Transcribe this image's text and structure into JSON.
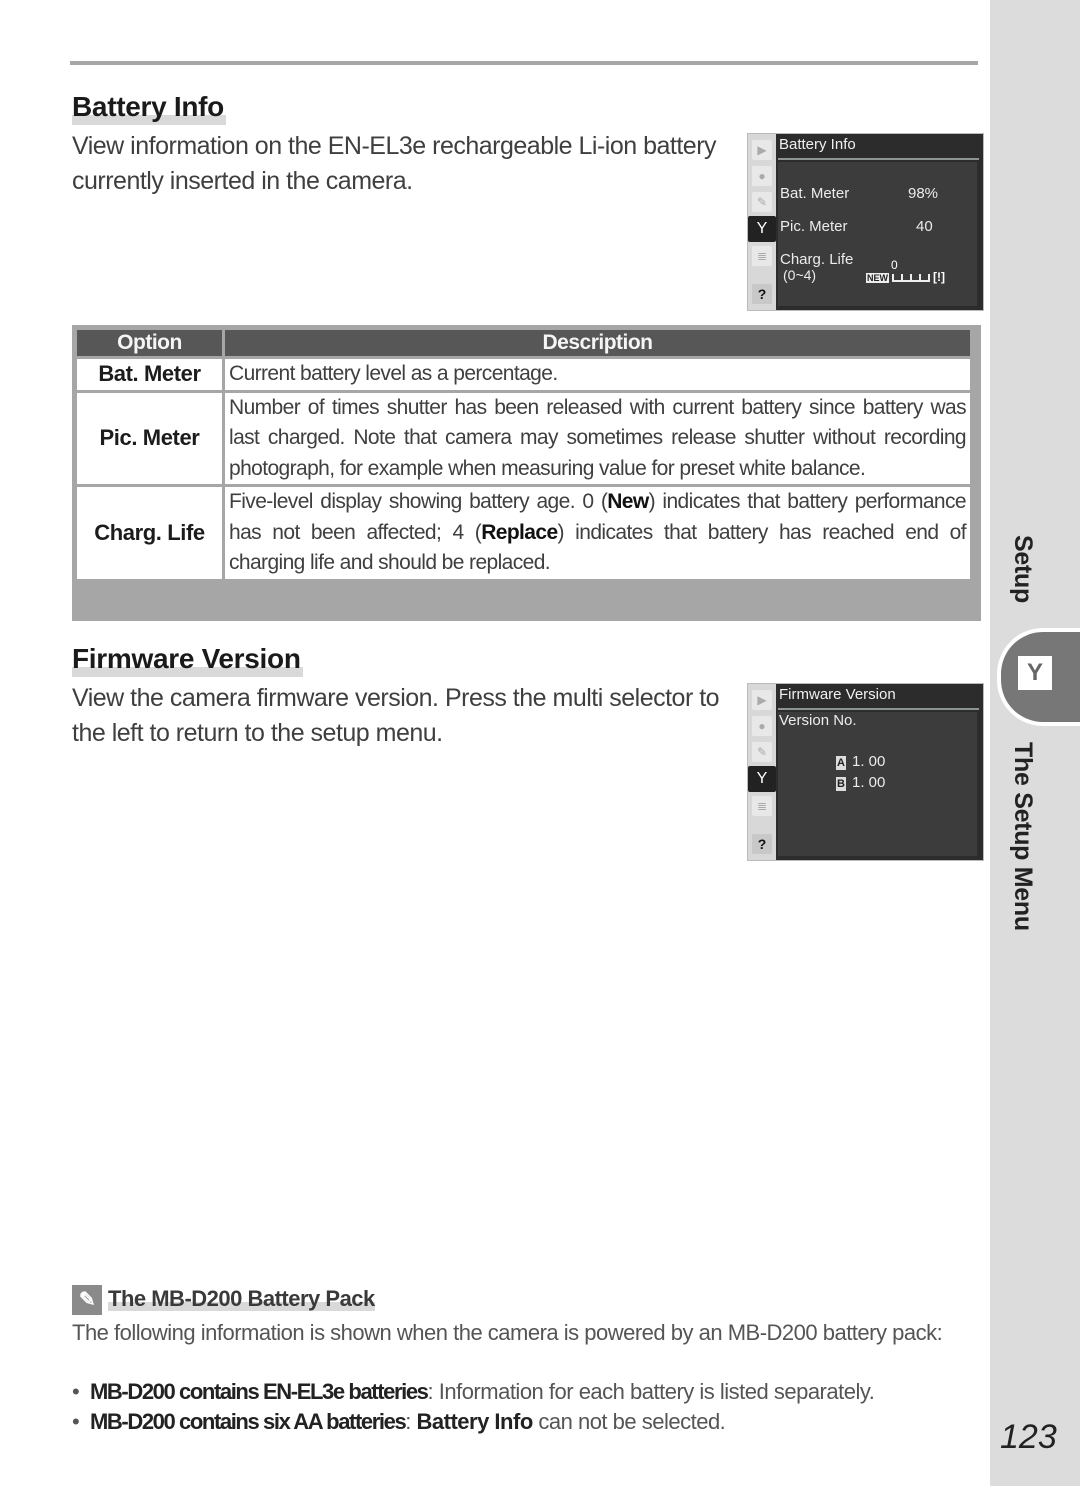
{
  "battery_info": {
    "heading": "Battery Info",
    "intro": "View information on the EN-EL3e rechargeable Li-ion battery currently inserted in the camera.",
    "screen": {
      "title": "Battery Info",
      "sidebar_icons": [
        "playback-icon",
        "shooting-icon",
        "custom-settings-icon",
        "setup-icon",
        "my-menu-icon",
        "help-icon"
      ],
      "help_glyph": "?",
      "rows": [
        {
          "label": "Bat. Meter",
          "value": "98%"
        },
        {
          "label": "Pic. Meter",
          "value": "40"
        },
        {
          "label": "Charg. Life",
          "sublabel": "(0~4)",
          "value": "0"
        }
      ],
      "gauge": {
        "new_label": "NEW",
        "replace_glyph": "!",
        "level": 0,
        "max": 4
      }
    }
  },
  "table": {
    "headers": [
      "Option",
      "Description"
    ],
    "rows": [
      {
        "option": "Bat. Meter",
        "description": "Current battery level as a percentage."
      },
      {
        "option": "Pic. Meter",
        "description": "Number of times shutter has been released with current battery since battery was last charged.  Note that camera may sometimes release shutter without recording photograph, for example when measuring value for preset white balance."
      },
      {
        "option": "Charg. Life",
        "description_parts": [
          "Five-level display showing battery age.  0 (",
          "New",
          ") indicates that battery performance has not been affected; 4 (",
          "Replace",
          ") indicates that battery has reached end of charging life and should be replaced."
        ]
      }
    ]
  },
  "firmware": {
    "heading": "Firmware Version",
    "intro": "View the camera firmware version.  Press the multi selector to the left to return to the setup menu.",
    "screen": {
      "title": "Firmware Version",
      "label": "Version No.",
      "versions": [
        {
          "tag": "A",
          "value": "1. 00"
        },
        {
          "tag": "B",
          "value": "1. 00"
        }
      ],
      "help_glyph": "?"
    }
  },
  "note": {
    "heading": "The MB-D200 Battery Pack",
    "body": "The following information is shown when the camera is powered by an MB-D200 battery pack:",
    "bullets": [
      {
        "condition": "MB-D200 contains EN-EL3e batteries",
        "text": ": Information for each battery is listed separately."
      },
      {
        "condition": "MB-D200 contains six AA batteries",
        "text_before": ": ",
        "ui_term": "Battery Info",
        "text_after": " can not be selected."
      }
    ]
  },
  "side_tab": {
    "section": "Setup",
    "chapter": "The Setup Menu",
    "icon": "wrench-icon"
  },
  "page_number": "123"
}
